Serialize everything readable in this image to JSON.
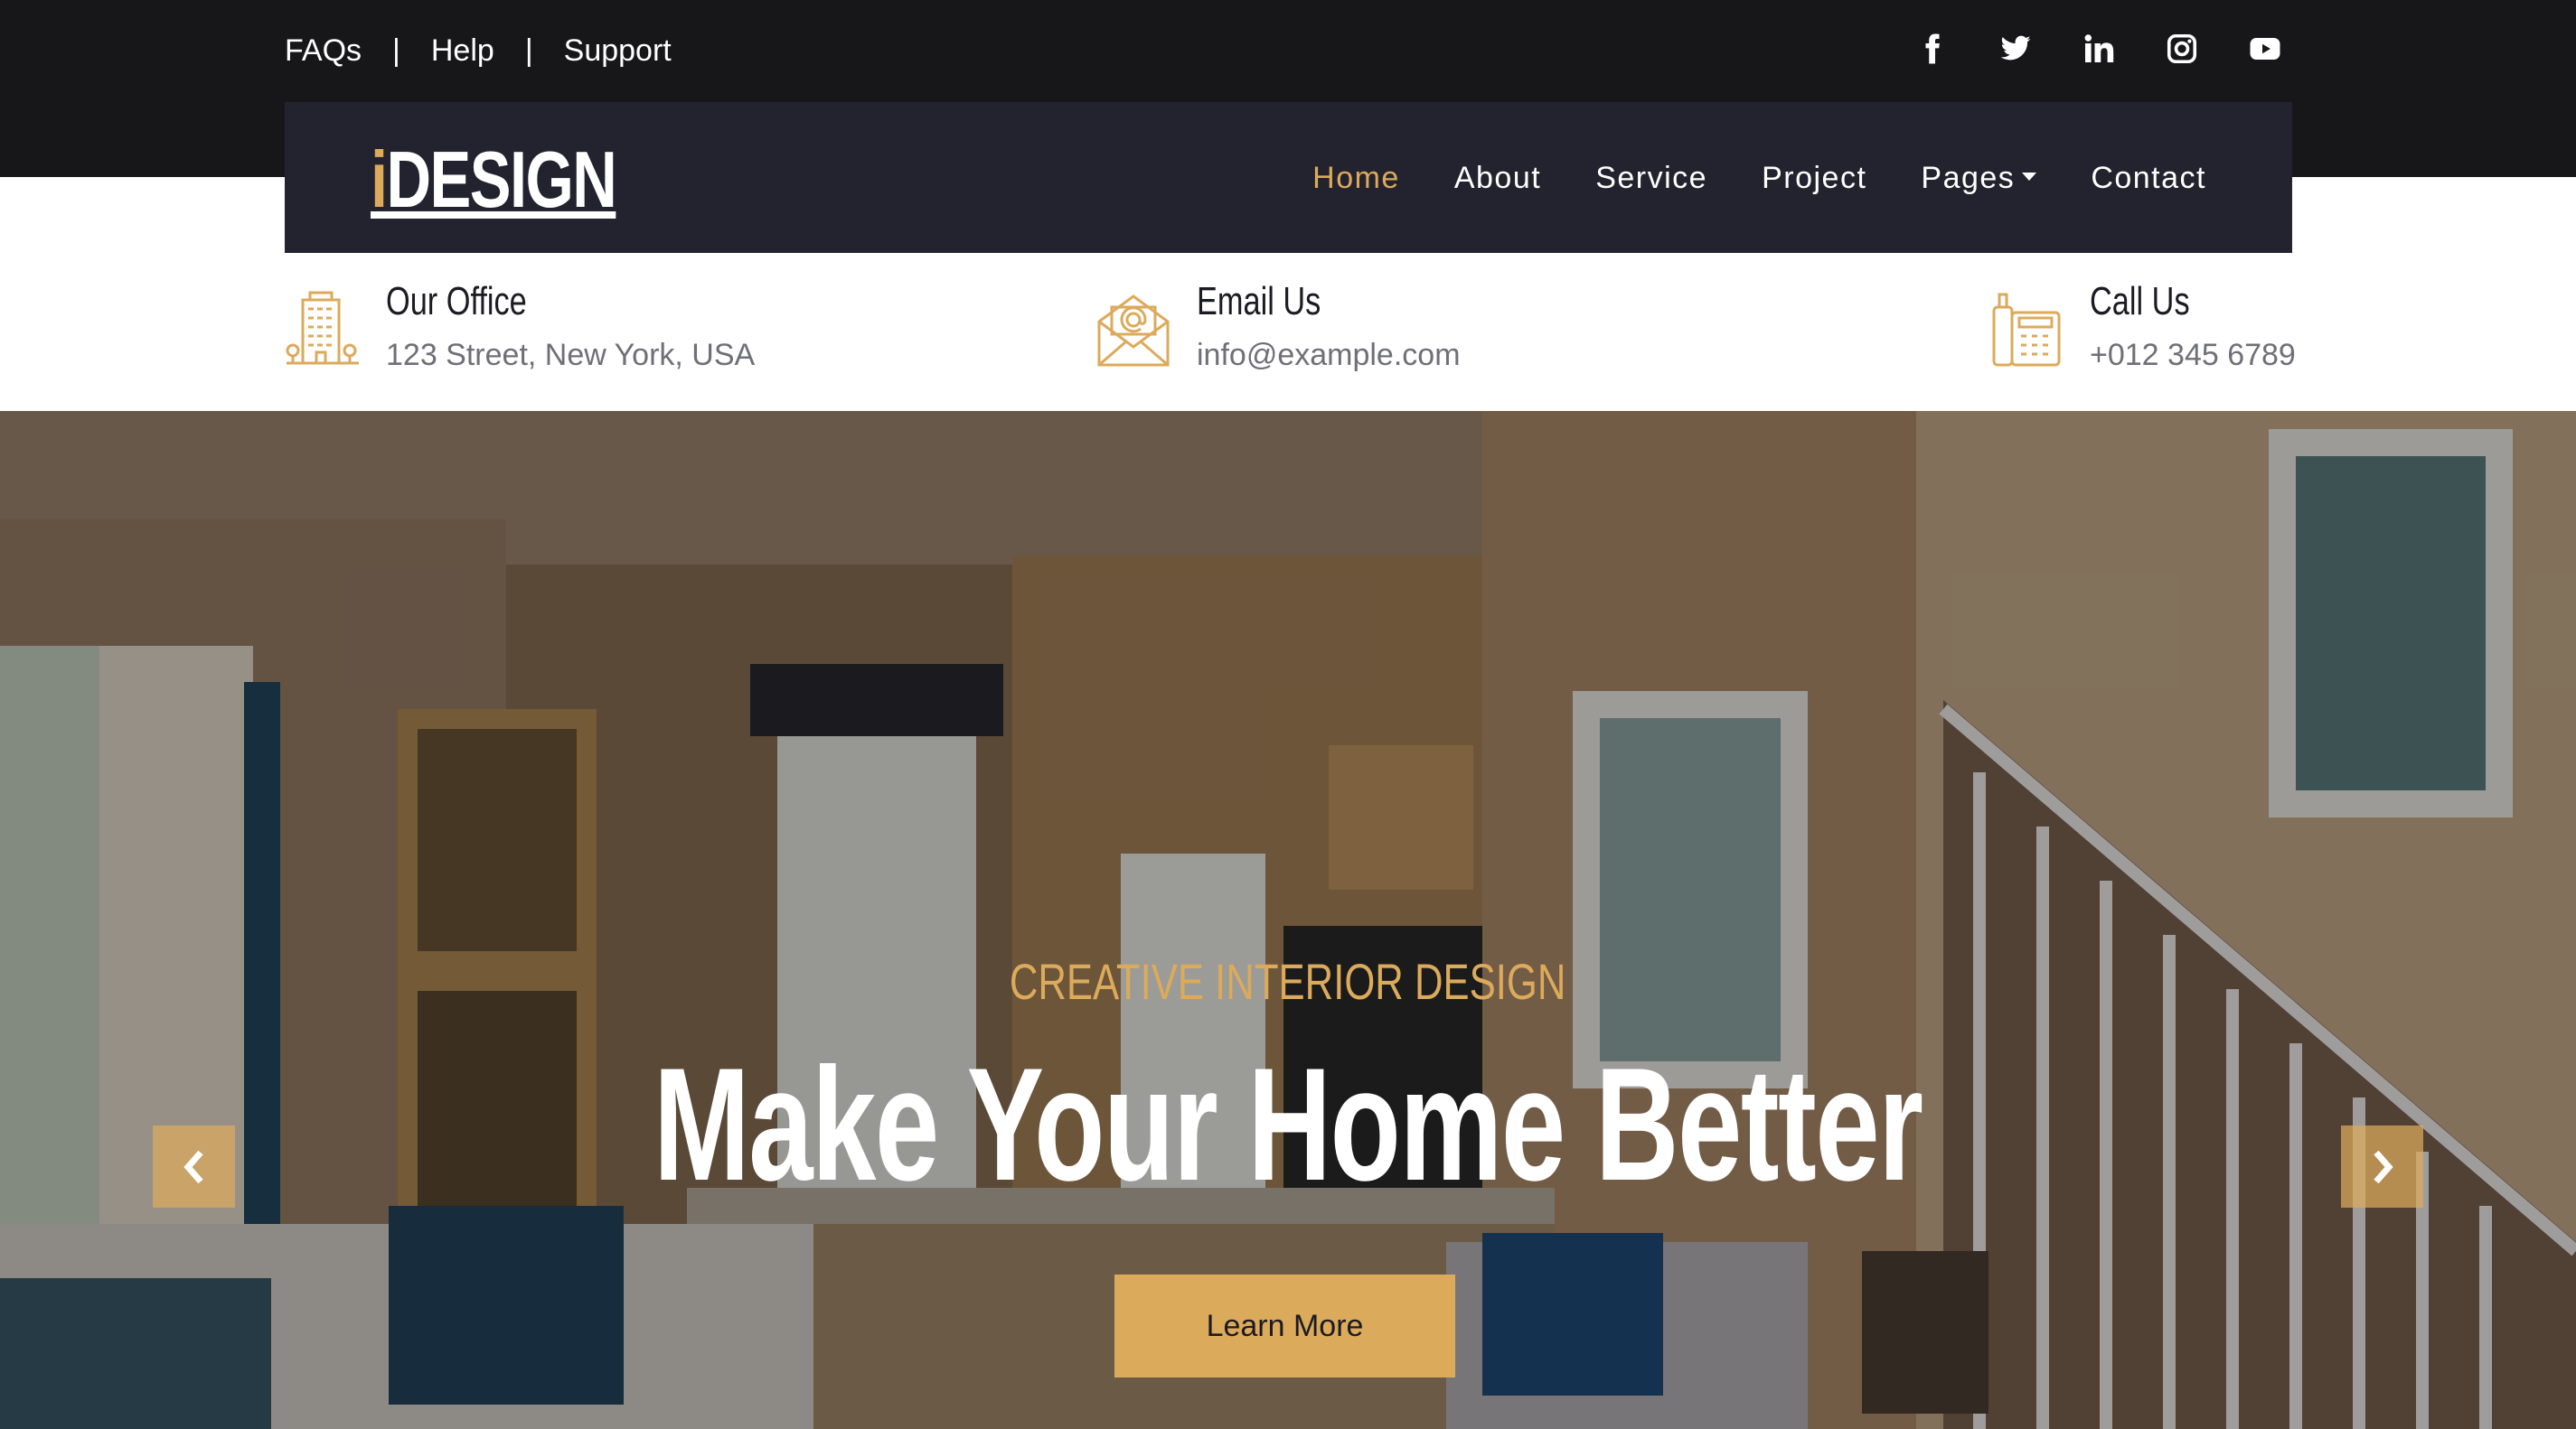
{
  "topbar": {
    "links": [
      "FAQs",
      "Help",
      "Support"
    ],
    "separator": "|",
    "social_icons": [
      "facebook-icon",
      "twitter-icon",
      "linkedin-icon",
      "instagram-icon",
      "youtube-icon"
    ]
  },
  "brand": {
    "logo_accent": "i",
    "logo_rest": "DESIGN"
  },
  "nav": {
    "items": [
      "Home",
      "About",
      "Service",
      "Project",
      "Pages",
      "Contact"
    ],
    "active": "Home"
  },
  "info": [
    {
      "icon": "office-building-icon",
      "title": "Our Office",
      "value": "123 Street, New York, USA"
    },
    {
      "icon": "email-icon",
      "title": "Email Us",
      "value": "info@example.com"
    },
    {
      "icon": "phone-icon",
      "title": "Call Us",
      "value": "+012 345 6789"
    }
  ],
  "hero": {
    "tagline": "CREATIVE INTERIOR DESIGN",
    "headline": "Make Your Home Better",
    "button": "Learn More",
    "prev_icon": "chevron-left-icon",
    "next_icon": "chevron-right-icon"
  },
  "colors": {
    "accent": "#dcaa5b",
    "topbar_bg": "#17171a",
    "navbar_bg": "#232330",
    "text_dark": "#1b1b24",
    "text_muted": "#6f6f78"
  }
}
